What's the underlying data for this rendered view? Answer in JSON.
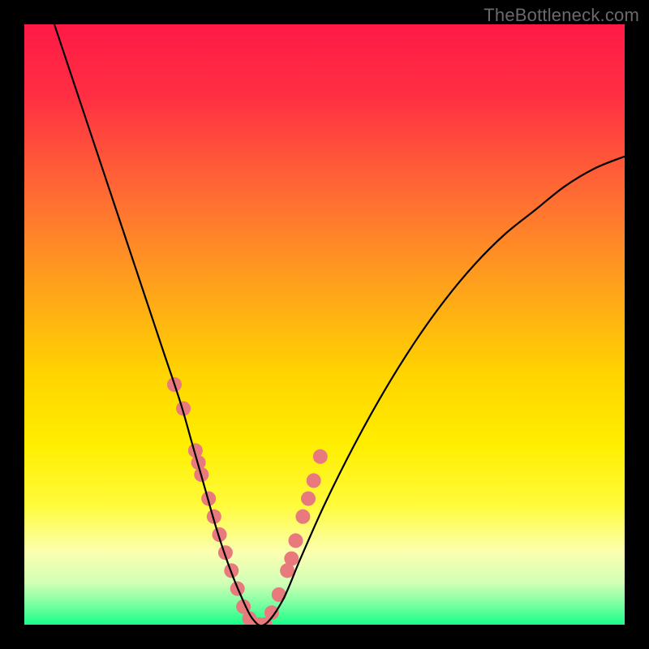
{
  "watermark": "TheBottleneck.com",
  "colors": {
    "background_frame": "#000000",
    "gradient_stops": [
      {
        "offset": 0.0,
        "color": "#ff1a46"
      },
      {
        "offset": 0.12,
        "color": "#ff2f43"
      },
      {
        "offset": 0.28,
        "color": "#ff6a34"
      },
      {
        "offset": 0.44,
        "color": "#ffa31b"
      },
      {
        "offset": 0.58,
        "color": "#ffd300"
      },
      {
        "offset": 0.7,
        "color": "#ffee00"
      },
      {
        "offset": 0.8,
        "color": "#fffb3a"
      },
      {
        "offset": 0.88,
        "color": "#fbffb0"
      },
      {
        "offset": 0.93,
        "color": "#d2ffb6"
      },
      {
        "offset": 0.965,
        "color": "#7dffa1"
      },
      {
        "offset": 1.0,
        "color": "#18ff88"
      }
    ],
    "curve": "#000000",
    "markers": "#e87a7d"
  },
  "chart_data": {
    "type": "line",
    "title": "",
    "xlabel": "",
    "ylabel": "",
    "xlim": [
      0,
      100
    ],
    "ylim": [
      0,
      100
    ],
    "series": [
      {
        "name": "bottleneck-curve",
        "x": [
          5,
          8,
          11,
          14,
          17,
          20,
          23,
          26,
          28,
          30,
          32,
          34,
          36,
          38,
          40,
          43,
          46,
          50,
          55,
          60,
          65,
          70,
          75,
          80,
          85,
          90,
          95,
          100
        ],
        "y": [
          100,
          91,
          82,
          73,
          64,
          55,
          46,
          37,
          30,
          23,
          16,
          10,
          5,
          1,
          0,
          4,
          11,
          20,
          30,
          39,
          47,
          54,
          60,
          65,
          69,
          73,
          76,
          78
        ]
      }
    ],
    "markers": {
      "name": "highlighted-points",
      "x": [
        25,
        26.5,
        28.5,
        29,
        29.5,
        30.7,
        31.6,
        32.5,
        33.5,
        34.5,
        35.5,
        36.5,
        37.5,
        38.3,
        39.2,
        40.1,
        41.2,
        42.4,
        43.8,
        44.5,
        45.2,
        46.4,
        47.3,
        48.2,
        49.3
      ],
      "y": [
        40,
        36,
        29,
        27,
        25,
        21,
        18,
        15,
        12,
        9,
        6,
        3,
        1,
        0,
        0,
        0,
        2,
        5,
        9,
        11,
        14,
        18,
        21,
        24,
        28
      ],
      "radius": 9
    }
  }
}
